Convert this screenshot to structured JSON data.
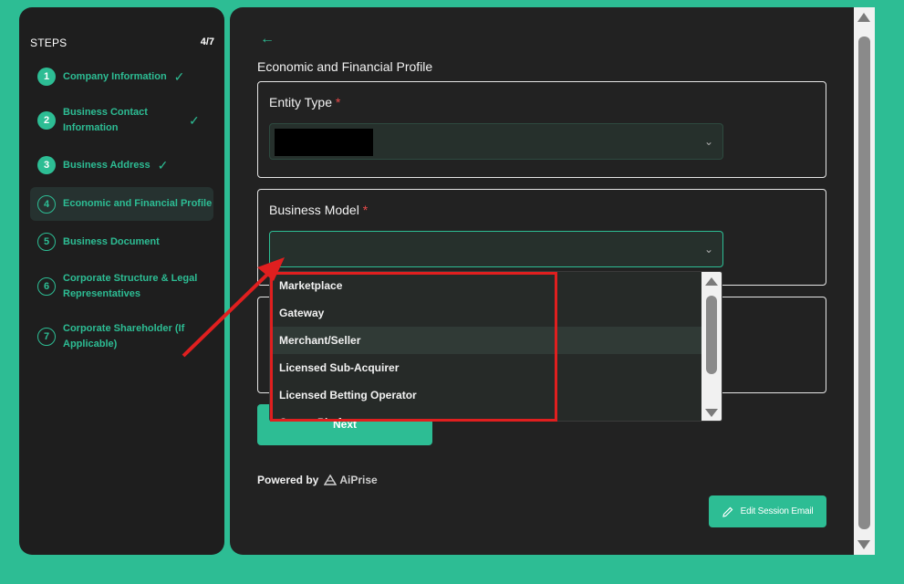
{
  "sidebar": {
    "title": "STEPS",
    "count": "4/7",
    "steps": [
      {
        "number": "1",
        "label": "Company Information",
        "status": "done"
      },
      {
        "number": "2",
        "label": "Business Contact Information",
        "status": "done"
      },
      {
        "number": "3",
        "label": "Business Address",
        "status": "done"
      },
      {
        "number": "4",
        "label": "Economic and Financial Profile",
        "status": "current"
      },
      {
        "number": "5",
        "label": "Business Document",
        "status": "pending"
      },
      {
        "number": "6",
        "label": "Corporate Structure & Legal Representatives",
        "status": "pending"
      },
      {
        "number": "7",
        "label": "Corporate Shareholder (If Applicable)",
        "status": "pending"
      }
    ]
  },
  "main": {
    "section_title": "Economic and Financial Profile",
    "entity_type": {
      "label": "Entity Type",
      "required_mark": "*"
    },
    "business_model": {
      "label": "Business Model",
      "required_mark": "*",
      "options": [
        "Marketplace",
        "Gateway",
        "Merchant/Seller",
        "Licensed Sub-Acquirer",
        "Licensed Betting Operator",
        "Crypto Platform"
      ],
      "hovered_option": "Merchant/Seller"
    },
    "next_label": "Next",
    "powered_by": "Powered by",
    "brand": "AiPrise",
    "edit_session_label": "Edit Session Email"
  },
  "colors": {
    "accent": "#2dbd94",
    "background": "#222222",
    "annotation": "#e01f1f",
    "required": "#e84a4a"
  },
  "icons": [
    "back-arrow-icon",
    "checkmark-icon",
    "chevron-down-icon",
    "pencil-icon",
    "aiprise-logo-icon"
  ]
}
